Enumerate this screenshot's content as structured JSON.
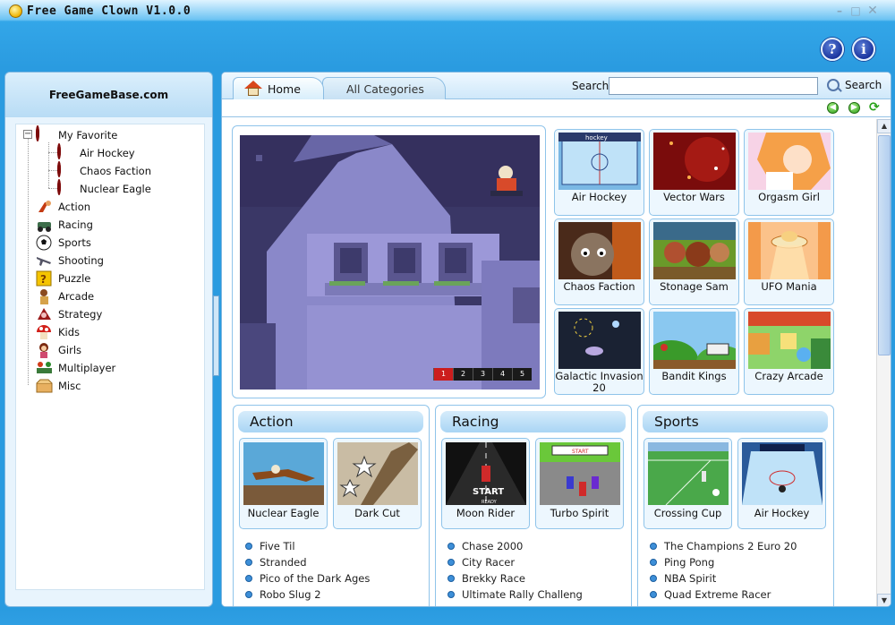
{
  "window": {
    "title": "Free Game Clown V1.0.0",
    "help_symbol": "?",
    "info_symbol": "i"
  },
  "sidebar": {
    "header": "FreeGameBase.com",
    "favorite": {
      "label": "My Favorite",
      "items": [
        "Air Hockey",
        "Chaos Faction",
        "Nuclear Eagle"
      ]
    },
    "categories": [
      "Action",
      "Racing",
      "Sports",
      "Shooting",
      "Puzzle",
      "Arcade",
      "Strategy",
      "Kids",
      "Girls",
      "Multiplayer",
      "Misc"
    ]
  },
  "tabs": {
    "home": "Home",
    "all_categories": "All Categories"
  },
  "search": {
    "label": "Search:",
    "value": "",
    "button": "Search"
  },
  "featured": {
    "pages": [
      "1",
      "2",
      "3",
      "4",
      "5"
    ],
    "active_page": "1"
  },
  "featured_thumbs": [
    "Air Hockey",
    "Vector Wars",
    "Orgasm Girl",
    "Chaos Faction",
    "Stonage Sam",
    "UFO Mania",
    "Galactic Invasion 20",
    "Bandit Kings",
    "Crazy Arcade"
  ],
  "sections": [
    {
      "title": "Action",
      "cards": [
        "Nuclear Eagle",
        "Dark Cut"
      ],
      "games": [
        "Five Til",
        "Stranded",
        "Pico of the Dark Ages",
        "Robo Slug 2"
      ]
    },
    {
      "title": "Racing",
      "cards": [
        "Moon Rider",
        "Turbo Spirit"
      ],
      "games": [
        "Chase 2000",
        "City Racer",
        "Brekky Race",
        "Ultimate Rally Challeng"
      ]
    },
    {
      "title": "Sports",
      "cards": [
        "Crossing Cup",
        "Air Hockey"
      ],
      "games": [
        "The Champions 2 Euro 20",
        "Ping Pong",
        "NBA Spirit",
        "Quad Extreme Racer"
      ]
    }
  ],
  "thumb_art": {
    "race_sign": "START",
    "race_ready": "READY",
    "race_track_start": "START",
    "air_hockey_logo": "hockey"
  },
  "colors": {
    "accent": "#2a9be0",
    "panel_border": "#8fc4ea",
    "header_fill": "#a9d5f4",
    "pager_active": "#cc1d1d"
  }
}
